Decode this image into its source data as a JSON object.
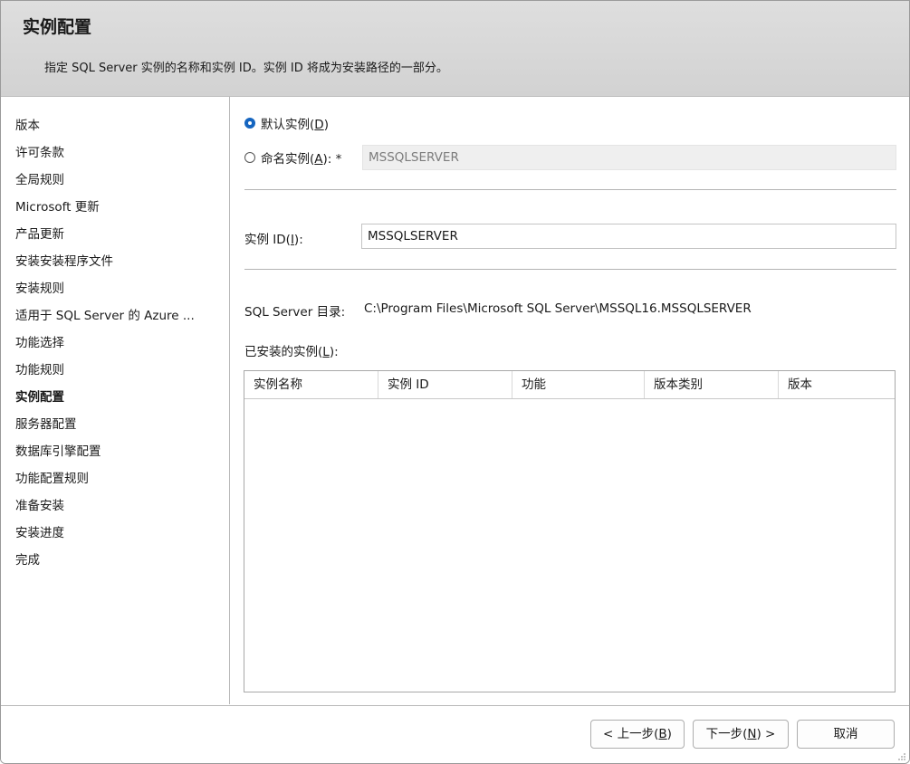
{
  "header": {
    "title": "实例配置",
    "description": "指定 SQL Server 实例的名称和实例 ID。实例 ID 将成为安装路径的一部分。"
  },
  "sidebar": {
    "items": [
      {
        "label": "版本"
      },
      {
        "label": "许可条款"
      },
      {
        "label": "全局规则"
      },
      {
        "label": "Microsoft 更新"
      },
      {
        "label": "产品更新"
      },
      {
        "label": "安装安装程序文件"
      },
      {
        "label": "安装规则"
      },
      {
        "label": "适用于 SQL Server 的 Azure ..."
      },
      {
        "label": "功能选择"
      },
      {
        "label": "功能规则"
      },
      {
        "label": "实例配置"
      },
      {
        "label": "服务器配置"
      },
      {
        "label": "数据库引擎配置"
      },
      {
        "label": "功能配置规则"
      },
      {
        "label": "准备安装"
      },
      {
        "label": "安装进度"
      },
      {
        "label": "完成"
      }
    ],
    "active": "实例配置"
  },
  "form": {
    "default_instance": {
      "label": "默认实例(",
      "key": "D",
      "suffix": ")",
      "checked": true
    },
    "named_instance": {
      "label": "命名实例(",
      "key": "A",
      "suffix": "): *",
      "checked": false,
      "value": "MSSQLSERVER"
    },
    "instance_id": {
      "label": "实例 ID(",
      "key": "I",
      "suffix": "):",
      "value": "MSSQLSERVER"
    },
    "directory": {
      "label": "SQL Server 目录:",
      "value": "C:\\Program Files\\Microsoft SQL Server\\MSSQL16.MSSQLSERVER"
    },
    "installed": {
      "label": "已安装的实例(",
      "key": "L",
      "suffix": "):"
    }
  },
  "table": {
    "columns": [
      "实例名称",
      "实例 ID",
      "功能",
      "版本类别",
      "版本"
    ],
    "rows": []
  },
  "footer": {
    "back": {
      "pre": "< 上一步(",
      "key": "B",
      "post": ")"
    },
    "next": {
      "pre": "下一步(",
      "key": "N",
      "post": ") >"
    },
    "cancel": "取消"
  },
  "colors": {
    "accent": "#1565c0",
    "header_bg": "#d8d8d8"
  }
}
